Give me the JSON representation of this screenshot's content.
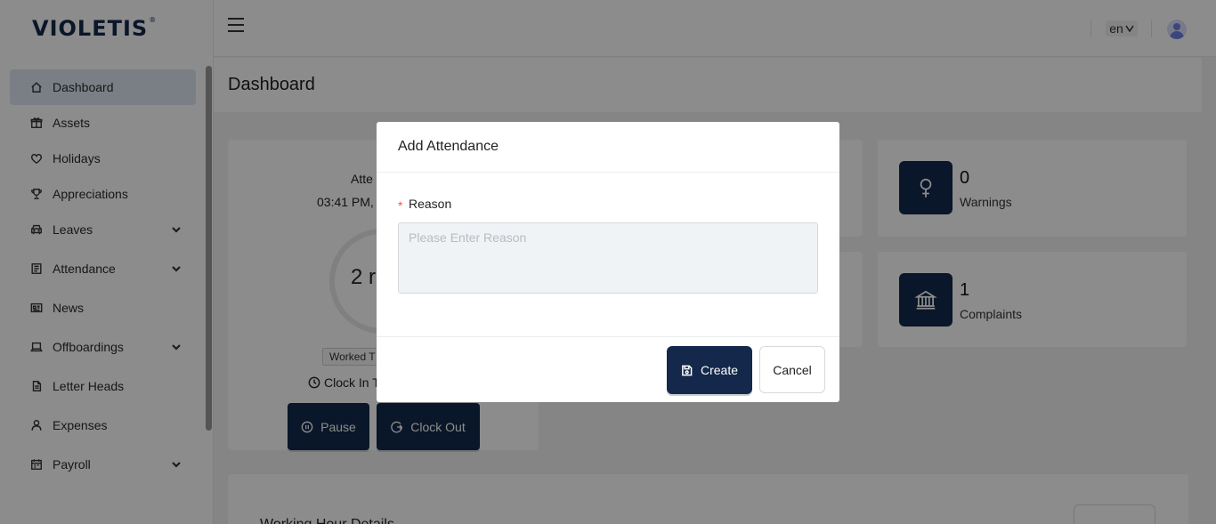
{
  "brand": {
    "logo_text": "VIOLETIS",
    "registered_mark": "®"
  },
  "sidebar": {
    "items": [
      {
        "label": "Dashboard",
        "icon": "home-icon",
        "active": true,
        "has_chevron": false
      },
      {
        "label": "Assets",
        "icon": "gift-icon",
        "has_chevron": false
      },
      {
        "label": "Holidays",
        "icon": "heart-icon",
        "has_chevron": false
      },
      {
        "label": "Appreciations",
        "icon": "trophy-icon",
        "has_chevron": false
      },
      {
        "label": "Leaves",
        "icon": "car-icon",
        "has_chevron": true
      },
      {
        "label": "Attendance",
        "icon": "list-icon",
        "has_chevron": true
      },
      {
        "label": "News",
        "icon": "newspaper-icon",
        "has_chevron": false
      },
      {
        "label": "Offboardings",
        "icon": "laptop-icon",
        "has_chevron": true
      },
      {
        "label": "Letter Heads",
        "icon": "document-icon",
        "has_chevron": false
      },
      {
        "label": "Expenses",
        "icon": "user-icon",
        "has_chevron": false
      },
      {
        "label": "Payroll",
        "icon": "calendar-icon",
        "has_chevron": true
      }
    ]
  },
  "header": {
    "language": "en"
  },
  "page": {
    "title": "Dashboard"
  },
  "attendance_card": {
    "title_partial": "Atte",
    "time_partial": "03:41 PM,",
    "ring_text_partial": "2 r",
    "worked_badge_partial": "Worked T",
    "clock_in_partial": "Clock In T",
    "pause_label": "Pause",
    "clock_out_label": "Clock Out"
  },
  "stats": {
    "warnings": {
      "value": "0",
      "label": "Warnings",
      "icon": "female-icon"
    },
    "complaints": {
      "value": "1",
      "label": "Complaints",
      "icon": "bank-icon"
    }
  },
  "bottom_section": {
    "title_partial": "Working Hour Details"
  },
  "modal": {
    "title": "Add Attendance",
    "required_mark": "*",
    "field_label": "Reason",
    "field_placeholder": "Please Enter Reason",
    "field_value": "",
    "create_label": "Create",
    "cancel_label": "Cancel"
  },
  "colors": {
    "primary": "#13284b",
    "sidebar_active_bg": "#dfe7f2",
    "required": "#ff4d4f",
    "input_bg": "#f0f3f5",
    "overlay": "rgba(0,0,0,0.45)"
  }
}
